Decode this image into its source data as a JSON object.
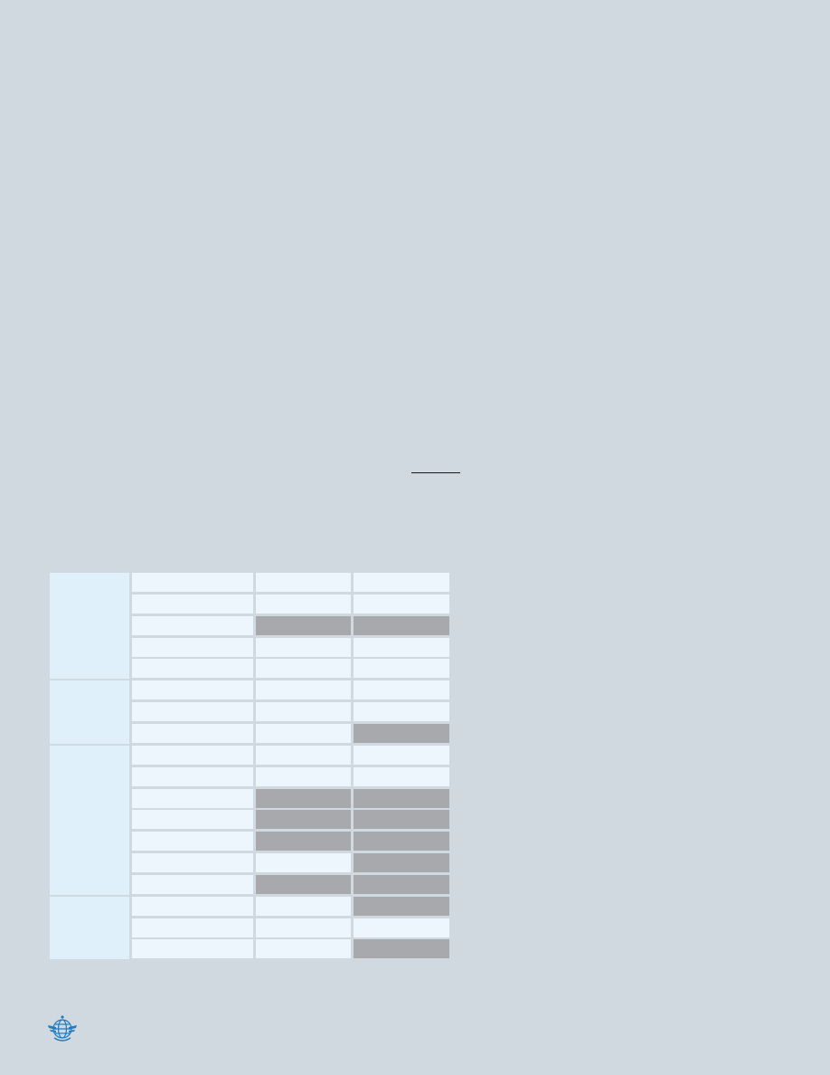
{
  "page": {
    "background_color": "#d1d9e0"
  },
  "table": {
    "colors": {
      "group_fill": "#e0f0fb",
      "cell_fill": "#eef6fd",
      "shaded_fill": "#a7a9ac"
    },
    "groups": [
      {
        "rows": [
          {
            "shaded": [
              false,
              false,
              false
            ]
          },
          {
            "shaded": [
              false,
              false,
              false
            ]
          },
          {
            "shaded": [
              false,
              true,
              true
            ]
          },
          {
            "shaded": [
              false,
              false,
              false
            ]
          },
          {
            "shaded": [
              false,
              false,
              false
            ]
          }
        ]
      },
      {
        "rows": [
          {
            "shaded": [
              false,
              false,
              false
            ]
          },
          {
            "shaded": [
              false,
              false,
              false
            ]
          },
          {
            "shaded": [
              false,
              false,
              true
            ]
          }
        ]
      },
      {
        "rows": [
          {
            "shaded": [
              false,
              false,
              false
            ]
          },
          {
            "shaded": [
              false,
              false,
              false
            ]
          },
          {
            "shaded": [
              false,
              true,
              true
            ]
          },
          {
            "shaded": [
              false,
              true,
              true
            ]
          },
          {
            "shaded": [
              false,
              true,
              true
            ]
          },
          {
            "shaded": [
              false,
              false,
              true
            ]
          },
          {
            "shaded": [
              false,
              true,
              true
            ]
          }
        ]
      },
      {
        "rows": [
          {
            "shaded": [
              false,
              false,
              true
            ]
          },
          {
            "shaded": [
              false,
              false,
              false
            ]
          },
          {
            "shaded": [
              false,
              false,
              true
            ]
          }
        ]
      }
    ]
  },
  "logo": {
    "icon": "icao-emblem-icon",
    "color": "#1f7cc1"
  }
}
